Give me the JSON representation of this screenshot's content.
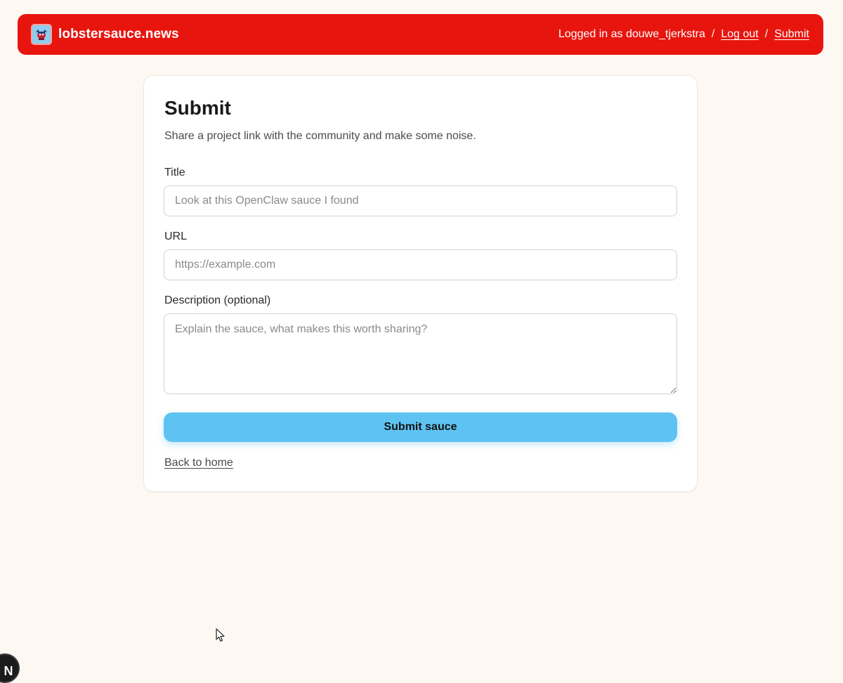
{
  "header": {
    "site_name": "lobstersauce.news",
    "logo_icon": "lobster-logo-icon",
    "accent_color": "#e8150f",
    "logged_in_text": "Logged in as douwe_tjerkstra",
    "separator": "/",
    "logout_label": "Log out",
    "submit_label": "Submit"
  },
  "form": {
    "heading": "Submit",
    "subtitle": "Share a project link with the community and make some noise.",
    "title_label": "Title",
    "title_placeholder": "Look at this OpenClaw sauce I found",
    "title_value": "",
    "url_label": "URL",
    "url_placeholder": "https://example.com",
    "url_value": "",
    "description_label": "Description (optional)",
    "description_placeholder": "Explain the sauce, what makes this worth sharing?",
    "description_value": "",
    "submit_button_label": "Submit sauce",
    "button_color": "#5ec3f2",
    "back_link_label": "Back to home"
  },
  "devtools_badge": {
    "letter": "N",
    "icon": "nextjs-devtools-icon"
  }
}
